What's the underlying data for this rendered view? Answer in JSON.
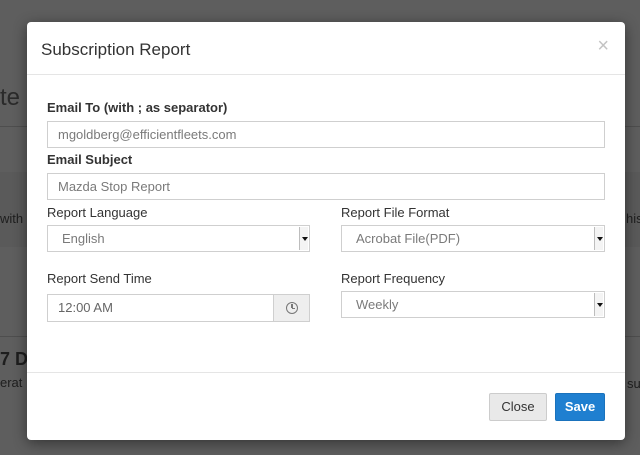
{
  "background": {
    "title_fragment": "te r",
    "row1_left_fragment": "with",
    "row1_right_fragment": "his",
    "heading_fragment": "7 D",
    "row2_left_fragment": "erat",
    "row2_right_fragment": "su"
  },
  "modal": {
    "title": "Subscription Report",
    "close_glyph": "×",
    "email_to": {
      "label": "Email To (with ; as separator)",
      "value": "mgoldberg@efficientfleets.com"
    },
    "email_subject": {
      "label": "Email Subject",
      "value": "Mazda Stop Report"
    },
    "report_language": {
      "label": "Report Language",
      "value": "English"
    },
    "report_file_format": {
      "label": "Report File Format",
      "value": "Acrobat File(PDF)"
    },
    "report_send_time": {
      "label": "Report Send Time",
      "value": "12:00 AM",
      "icon": "clock-icon"
    },
    "report_frequency": {
      "label": "Report Frequency",
      "value": "Weekly"
    },
    "buttons": {
      "close": "Close",
      "save": "Save"
    },
    "colors": {
      "primary": "#1f7fd0",
      "overlay": "#5e5e5e"
    }
  }
}
